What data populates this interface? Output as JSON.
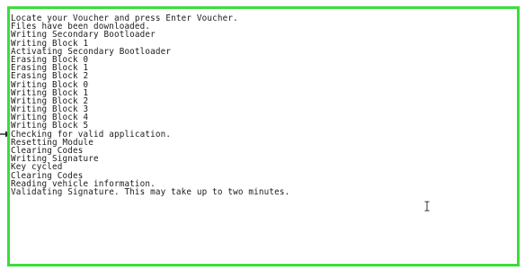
{
  "log": {
    "lines": [
      "Locate your Voucher and press Enter Voucher.",
      "Files have been downloaded.",
      "Writing Secondary Bootloader",
      "Writing Block 1",
      "Activating Secondary Bootloader",
      "Erasing Block 0",
      "Erasing Block 1",
      "Erasing Block 2",
      "Writing Block 0",
      "Writing Block 1",
      "Writing Block 2",
      "Writing Block 3",
      "Writing Block 4",
      "Writing Block 5",
      "Checking for valid application.",
      "Resetting Module",
      "Clearing Codes",
      "Writing Signature",
      "Key cycled",
      "Clearing Codes",
      "Reading vehicle information.",
      "Validating Signature. This may take up to two minutes."
    ]
  },
  "colors": {
    "panel_border": "#3ddc3d",
    "text": "#1a1a1a",
    "background": "#ffffff"
  },
  "icons": {
    "pointer": "arrow-pointer-icon",
    "cursor": "text-cursor-icon"
  }
}
